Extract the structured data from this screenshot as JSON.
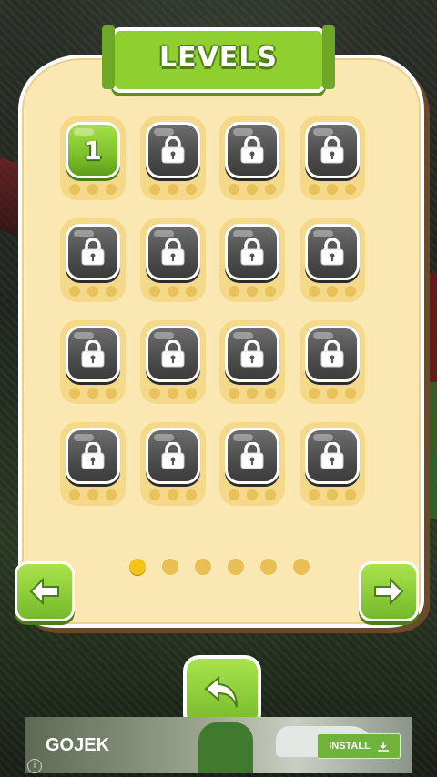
{
  "screen_title": "LEVELS",
  "levels": [
    {
      "number": "1",
      "state": "unlocked"
    },
    {
      "number": "",
      "state": "locked"
    },
    {
      "number": "",
      "state": "locked"
    },
    {
      "number": "",
      "state": "locked"
    },
    {
      "number": "",
      "state": "locked"
    },
    {
      "number": "",
      "state": "locked"
    },
    {
      "number": "",
      "state": "locked"
    },
    {
      "number": "",
      "state": "locked"
    },
    {
      "number": "",
      "state": "locked"
    },
    {
      "number": "",
      "state": "locked"
    },
    {
      "number": "",
      "state": "locked"
    },
    {
      "number": "",
      "state": "locked"
    },
    {
      "number": "",
      "state": "locked"
    },
    {
      "number": "",
      "state": "locked"
    },
    {
      "number": "",
      "state": "locked"
    },
    {
      "number": "",
      "state": "locked"
    }
  ],
  "pagination": {
    "total_pages": 6,
    "current_page": 1
  },
  "navigation": {
    "prev_icon": "arrow-left-icon",
    "next_icon": "arrow-right-icon",
    "back_icon": "back-curved-arrow-icon"
  },
  "ad": {
    "brand": "GOJEK",
    "install_label": "INSTALL",
    "info_glyph": "i"
  },
  "colors": {
    "panel": "#fbe7b2",
    "accent_green": "#8fcf2f",
    "locked_gray": "#4c4c4c",
    "dot_active": "#f2c21d",
    "dot_inactive": "#e9be55"
  }
}
